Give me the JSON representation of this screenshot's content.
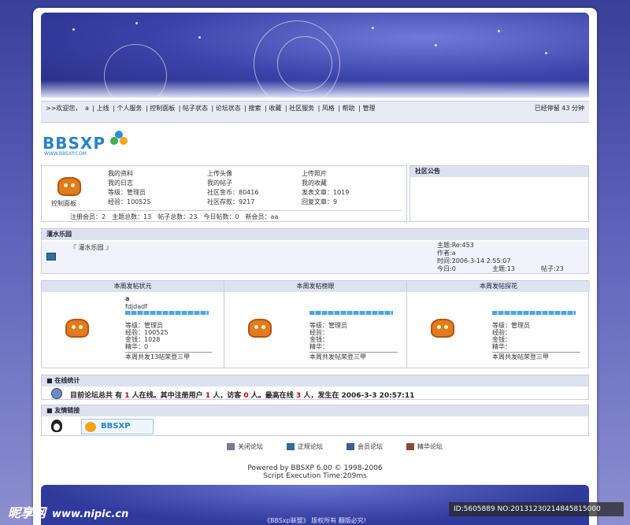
{
  "nav": {
    "welcome": ">>欢迎您，",
    "user": "a",
    "links": [
      "上线",
      "个人服务",
      "控制面板",
      "帖子状态",
      "论坛状态",
      "搜索",
      "收藏",
      "社区服务",
      "风格",
      "帮助"
    ],
    "logout": "管理",
    "online_time": "已经停留 43 分钟"
  },
  "logo": {
    "text": "BBSXP",
    "url": "WWW.BBSXP.COM"
  },
  "user_panel": {
    "control_label": "控制面板",
    "col1": [
      "我的资料",
      "我的日志",
      "等级：管理员",
      "经验：100525"
    ],
    "col2": [
      "上传头像",
      "我的帖子",
      "社区金币：80416",
      "社区存款：9217"
    ],
    "col3": [
      "上传照片",
      "我的收藏",
      "发表文章：1019",
      "回复文章：9"
    ],
    "stats": "注册会员：2　主题总数：13　帖子总数：23　今日帖数：0　新会员：aa"
  },
  "announcement": {
    "title": "社区公告"
  },
  "forum": {
    "header": "灌水乐园",
    "name": "『 灌水乐园 』",
    "latest_topic": "主题:Re:453",
    "latest_author": "作者:a",
    "latest_time": "时间:2006-3-14 2:55:07",
    "today": "今日:0",
    "topics": "主题:13",
    "posts": "帖子:23"
  },
  "weekly": [
    {
      "title": "本周发帖状元",
      "name": "a",
      "sub": "fdjdadf",
      "lines": [
        "等级：管理员",
        "经验：100525",
        "金钱：1028",
        "精华：0"
      ],
      "summary": "本周共发13帖荣登三甲"
    },
    {
      "title": "本周发帖榜眼",
      "name": "",
      "sub": "",
      "lines": [
        "等级：管理员",
        "经验：",
        "金钱：",
        "精华："
      ],
      "summary": "本周共发帖荣登三甲"
    },
    {
      "title": "本周发帖探花",
      "name": "",
      "sub": "",
      "lines": [
        "等级：管理员",
        "经验：",
        "金钱：",
        "精华："
      ],
      "summary": "本周共发帖荣登三甲"
    }
  ],
  "online": {
    "header": "在线统计",
    "text_a": "目前论坛总共 有 ",
    "count_total": "1",
    "text_b": " 人在线。其中注册用户 ",
    "count_reg": "1",
    "text_c": " 人，访客 ",
    "count_guest": "0",
    "text_d": " 人。最高在线 ",
    "count_max": "3",
    "text_e": " 人，发生在 2006-3-3 20:57:11"
  },
  "friends": {
    "header": "友情链接",
    "logo_text": "BBSXP"
  },
  "legend": [
    "关闭论坛",
    "正规论坛",
    "会员论坛",
    "精华论坛"
  ],
  "footer": {
    "powered": "Powered by BBSXP 6.00 © 1998-2006",
    "exec": "Script Execution Time:209ms",
    "copyright": "《BBSxp联盟》 版权所有 翻版必究!"
  },
  "watermark": {
    "brand": "昵享网",
    "url": "www.nipic.cn",
    "id": "ID:5605889 NO:20131230214845815000"
  },
  "colors": {
    "banner": "#3a43a8",
    "header_bg": "#dde1f0",
    "bar": "#4aa6e0"
  }
}
